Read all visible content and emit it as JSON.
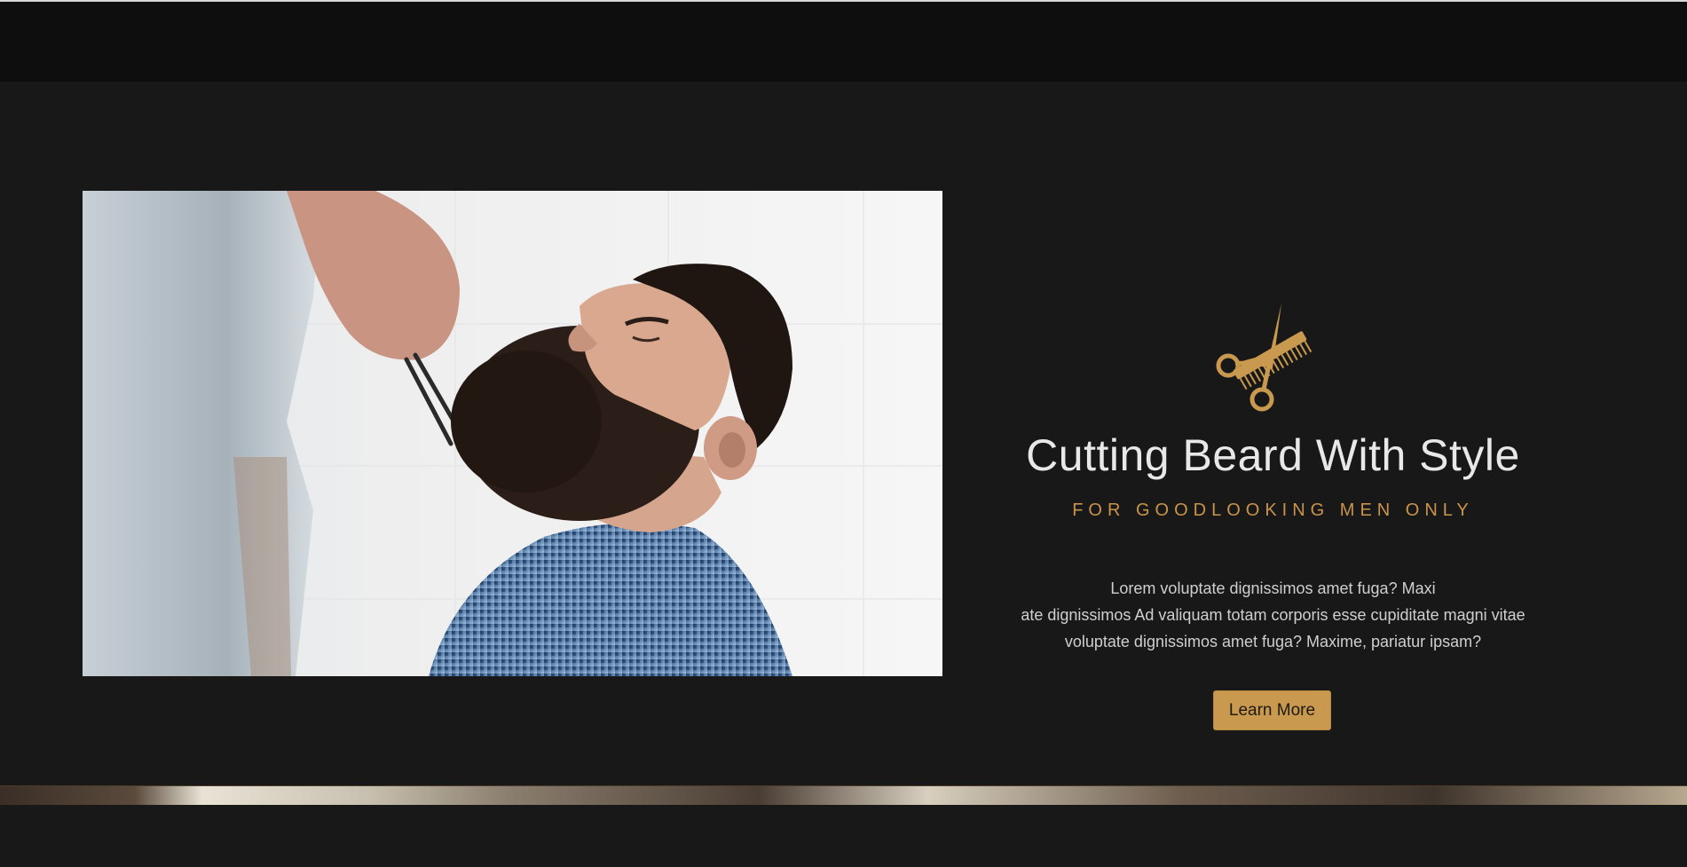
{
  "hero": {
    "image_alt": "Barber trimming a man's beard",
    "headline": "Cutting Beard With Style",
    "tagline": "FOR GOODLOOKING MEN ONLY",
    "body_lines": [
      "Lorem voluptate dignissimos amet fuga? Maxi",
      "ate dignissimos Ad valiquam totam corporis esse cupiditate magni vitae",
      "voluptate dignissimos amet fuga? Maxime, pariatur ipsam?"
    ],
    "button_label": "Learn More",
    "logo_icon": "scissors-comb-icon"
  },
  "colors": {
    "background": "#181818",
    "topbar": "#0f0e0f",
    "accent": "#c8994e",
    "headline": "#e8e8e8",
    "body": "#cfcfcf"
  }
}
